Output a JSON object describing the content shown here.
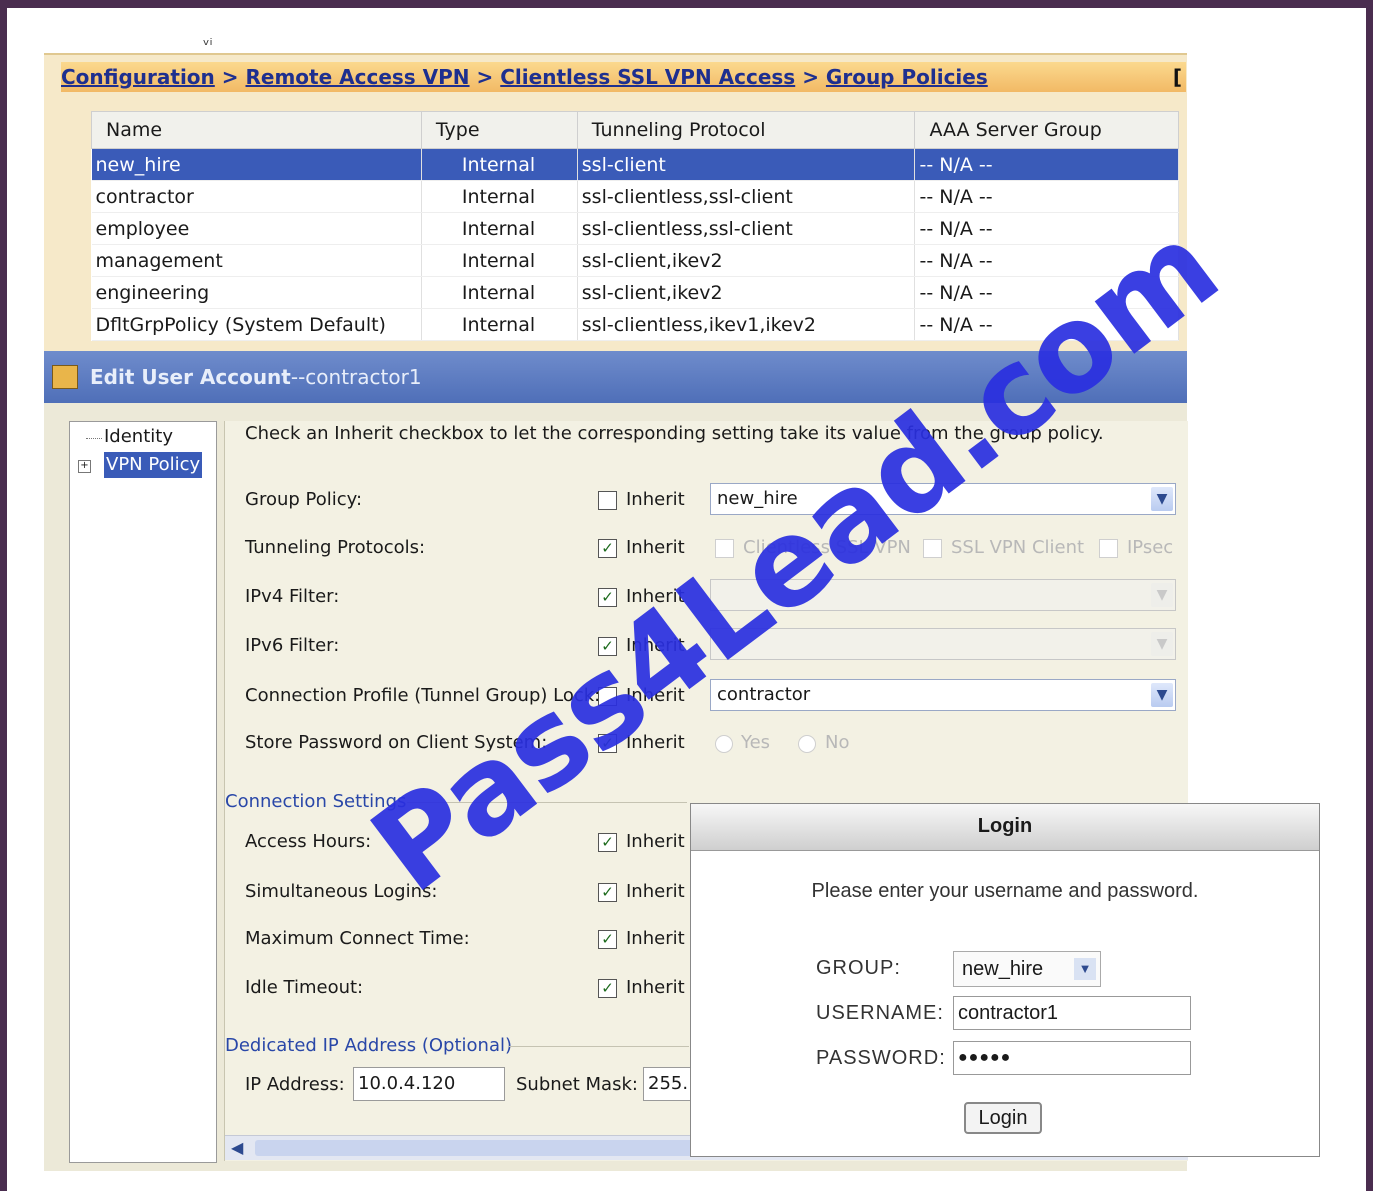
{
  "breadcrumb": {
    "items": [
      "Configuration",
      "Remote Access VPN",
      "Clientless SSL VPN Access",
      "Group Policies"
    ],
    "separator": ">",
    "end_glyph": "["
  },
  "group_policies": {
    "columns": [
      "Name",
      "Type",
      "Tunneling Protocol",
      "AAA Server Group"
    ],
    "rows": [
      {
        "name": "new_hire",
        "type": "Internal",
        "protocol": "ssl-client",
        "aaa": "-- N/A --",
        "selected": true
      },
      {
        "name": "contractor",
        "type": "Internal",
        "protocol": "ssl-clientless,ssl-client",
        "aaa": "-- N/A --"
      },
      {
        "name": "employee",
        "type": "Internal",
        "protocol": "ssl-clientless,ssl-client",
        "aaa": "-- N/A --"
      },
      {
        "name": "management",
        "type": "Internal",
        "protocol": "ssl-client,ikev2",
        "aaa": "-- N/A --"
      },
      {
        "name": "engineering",
        "type": "Internal",
        "protocol": "ssl-client,ikev2",
        "aaa": "-- N/A --"
      },
      {
        "name": "DfltGrpPolicy (System Default)",
        "type": "Internal",
        "protocol": "ssl-clientless,ikev1,ikev2",
        "aaa": "-- N/A --"
      }
    ]
  },
  "edit_window": {
    "title_bold": "Edit User Account",
    "title_rest": "--contractor1",
    "tree": {
      "identity": "Identity",
      "vpn_policy": "VPN Policy"
    },
    "hint": "Check an Inherit checkbox to let the corresponding setting take its value from the group policy.",
    "inherit_label": "Inherit",
    "group_policy": {
      "label": "Group Policy:",
      "value": "new_hire"
    },
    "tunneling": {
      "label": "Tunneling Protocols:",
      "opt1": "Clientless SSL VPN",
      "opt2": "SSL VPN Client",
      "opt3": "IPsec"
    },
    "ipv4": {
      "label": "IPv4 Filter:"
    },
    "ipv6": {
      "label": "IPv6 Filter:"
    },
    "conn_profile": {
      "label": "Connection Profile (Tunnel Group) Lock:",
      "value": "contractor"
    },
    "store_pw": {
      "label": "Store Password on Client System:",
      "yes": "Yes",
      "no": "No"
    },
    "conn_settings": "Connection Settings",
    "access_hours": "Access Hours:",
    "sim_logins": "Simultaneous Logins:",
    "max_connect": "Maximum Connect Time:",
    "idle_timeout": "Idle Timeout:",
    "dedicated_ip": "Dedicated IP Address (Optional)",
    "ip_label": "IP Address:",
    "ip_value": "10.0.4.120",
    "mask_label": "Subnet Mask:",
    "mask_value": "255."
  },
  "login": {
    "title": "Login",
    "message": "Please enter your username and password.",
    "group_label": "GROUP:",
    "group_value": "new_hire",
    "username_label": "USERNAME:",
    "username_value": "contractor1",
    "password_label": "PASSWORD:",
    "password_value": "●●●●●",
    "button": "Login"
  },
  "watermark": "Pass4Lead.com",
  "colors": {
    "selection": "#3a5bb8",
    "watermark": "#2a2fe0",
    "breadcrumb": "#1e2f8f"
  }
}
